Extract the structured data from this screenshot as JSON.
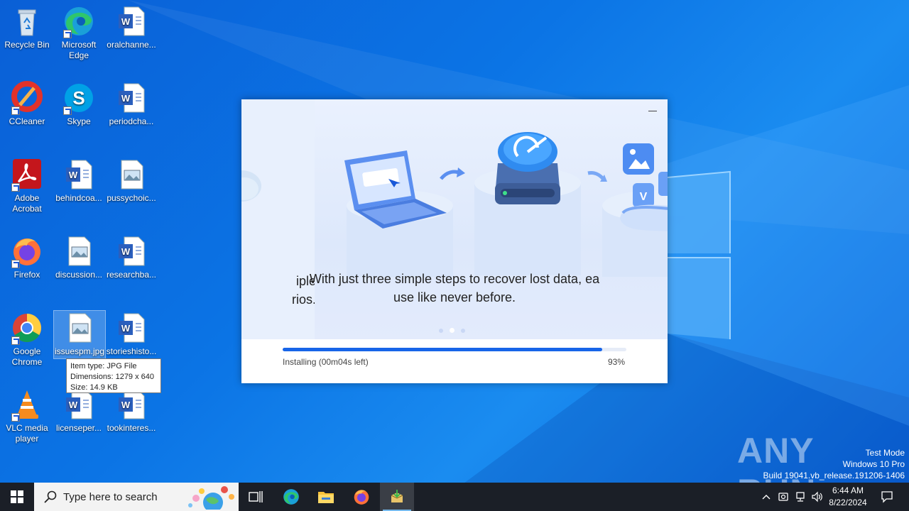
{
  "desktop": {
    "icons": [
      {
        "name": "recycle-bin",
        "label": "Recycle Bin"
      },
      {
        "name": "microsoft-edge",
        "label": "Microsoft Edge"
      },
      {
        "name": "oralchannel",
        "label": "oralchanne..."
      },
      {
        "name": "ccleaner",
        "label": "CCleaner"
      },
      {
        "name": "skype",
        "label": "Skype"
      },
      {
        "name": "periodcha",
        "label": "periodcha..."
      },
      {
        "name": "adobe-acrobat",
        "label": "Adobe Acrobat"
      },
      {
        "name": "behindcoa",
        "label": "behindcoa..."
      },
      {
        "name": "pussychoic",
        "label": "pussychoic..."
      },
      {
        "name": "firefox",
        "label": "Firefox"
      },
      {
        "name": "discussion",
        "label": "discussion..."
      },
      {
        "name": "researchba",
        "label": "researchba..."
      },
      {
        "name": "google-chrome",
        "label": "Google Chrome"
      },
      {
        "name": "issuespm",
        "label": "issuespm.jpg"
      },
      {
        "name": "storieshisto",
        "label": "storieshisto..."
      },
      {
        "name": "vlc",
        "label": "VLC media player"
      },
      {
        "name": "licenseper",
        "label": "licenseper..."
      },
      {
        "name": "tookinteres",
        "label": "tookinteres..."
      }
    ],
    "tooltip": {
      "line1": "Item type: JPG File",
      "line2": "Dimensions: 1279 x 640",
      "line3": "Size: 14.9 KB"
    }
  },
  "installer": {
    "prev_slide_line1": "iple",
    "prev_slide_line2": "rios.",
    "slide_line1": "With just three simple steps to recover lost data, ea",
    "slide_line2": "use like never before.",
    "status": "Installing (00m04s left)",
    "percent_label": "93%",
    "progress": 0.93
  },
  "watermark": {
    "brand": "ANY RUN",
    "line1": "Test Mode",
    "line2": "Windows 10 Pro",
    "line3": "Build 19041.vb_release.191206-1406"
  },
  "taskbar": {
    "search_placeholder": "Type here to search",
    "time": "6:44 AM",
    "date": "8/22/2024"
  },
  "colors": {
    "desktop": "#0b74e5",
    "accent": "#1865e8",
    "taskbar": "#1b1f27"
  }
}
